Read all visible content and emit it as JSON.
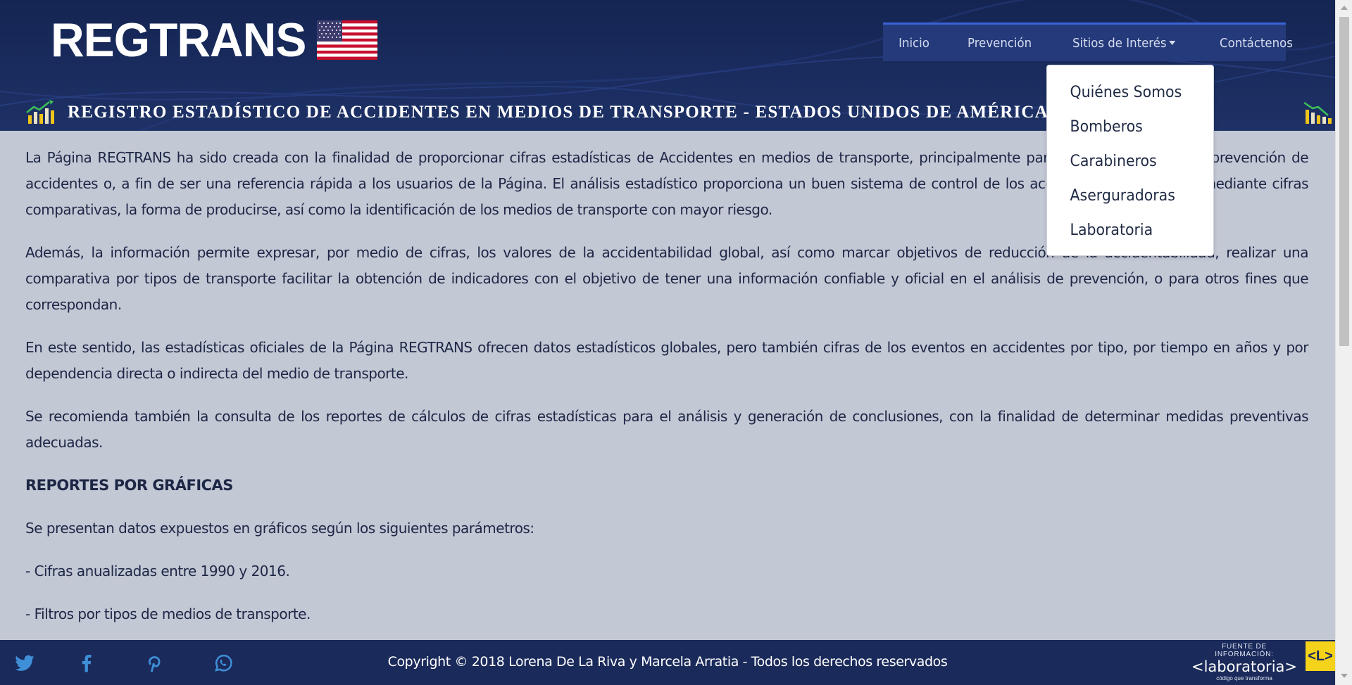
{
  "header": {
    "logo_text": "REGTRANS",
    "banner_text": "REGISTRO ESTADÍSTICO DE ACCIDENTES EN MEDIOS DE TRANSPORTE - ESTADOS UNIDOS DE AMÉRICA"
  },
  "nav": {
    "items": [
      {
        "label": "Inicio"
      },
      {
        "label": "Prevención"
      },
      {
        "label": "Sitios de Interés"
      },
      {
        "label": "Contáctenos"
      }
    ]
  },
  "dropdown": {
    "items": [
      {
        "label": "Quiénes Somos"
      },
      {
        "label": "Bomberos"
      },
      {
        "label": "Carabineros"
      },
      {
        "label": "Aserguradoras"
      },
      {
        "label": "Laboratoria"
      }
    ]
  },
  "content": {
    "paragraphs": [
      "La Página REGTRANS ha sido creada con la finalidad de proporcionar cifras estadísticas de Accidentes en medios de transporte, principalmente para apoyar el estudio de prevención de accidentes o, a fin de ser una referencia rápida a los usuarios de la Página. El análisis estadístico proporciona un buen sistema de control de los accidentes, su gravedad mediante cifras comparativas, la forma de producirse, así como la identificación de los medios de transporte con mayor riesgo.",
      "Además, la información permite expresar, por medio de cifras, los valores de la accidentabilidad global, así como marcar objetivos de reducción de la accidentabilidad, realizar una comparativa por tipos de transporte facilitar la obtención de indicadores con el objetivo de tener una información confiable y oficial en el análisis de prevención, o para otros fines que correspondan.",
      "En este sentido, las estadísticas oficiales de la Página REGTRANS ofrecen datos estadísticos globales, pero también cifras de los eventos en accidentes por tipo, por tiempo en años y por dependencia directa o indirecta del medio de transporte.",
      "Se recomienda también la consulta de los reportes de cálculos de cifras estadísticas para el análisis y generación de conclusiones, con la finalidad de determinar medidas preventivas adecuadas."
    ],
    "reports_heading": "REPORTES POR GRÁFICAS",
    "reports_intro": "Se presentan datos expuestos en gráficos según los siguientes parámetros:",
    "bullets": [
      "- Cifras anualizadas entre 1990 y 2016.",
      "- Filtros por tipos de medios de transporte."
    ]
  },
  "footer": {
    "social_icons": [
      "twitter-icon",
      "facebook-icon",
      "pinterest-icon",
      "whatsapp-icon"
    ],
    "copyright": "Copyright © 2018 Lorena De La Riva y Marcela Arratia - Todos los derechos reservados",
    "source_label": "FUENTE DE INFORMACIÓN:",
    "source_name": "<laboratoria>",
    "source_tagline": "código que transforma",
    "source_badge": "<L>"
  },
  "colors": {
    "header_bg": "#1a2c5e",
    "page_bg": "#c3c8d5",
    "text": "#1d2745",
    "nav_bg": "#243a7a",
    "badge": "#f6d31b"
  }
}
